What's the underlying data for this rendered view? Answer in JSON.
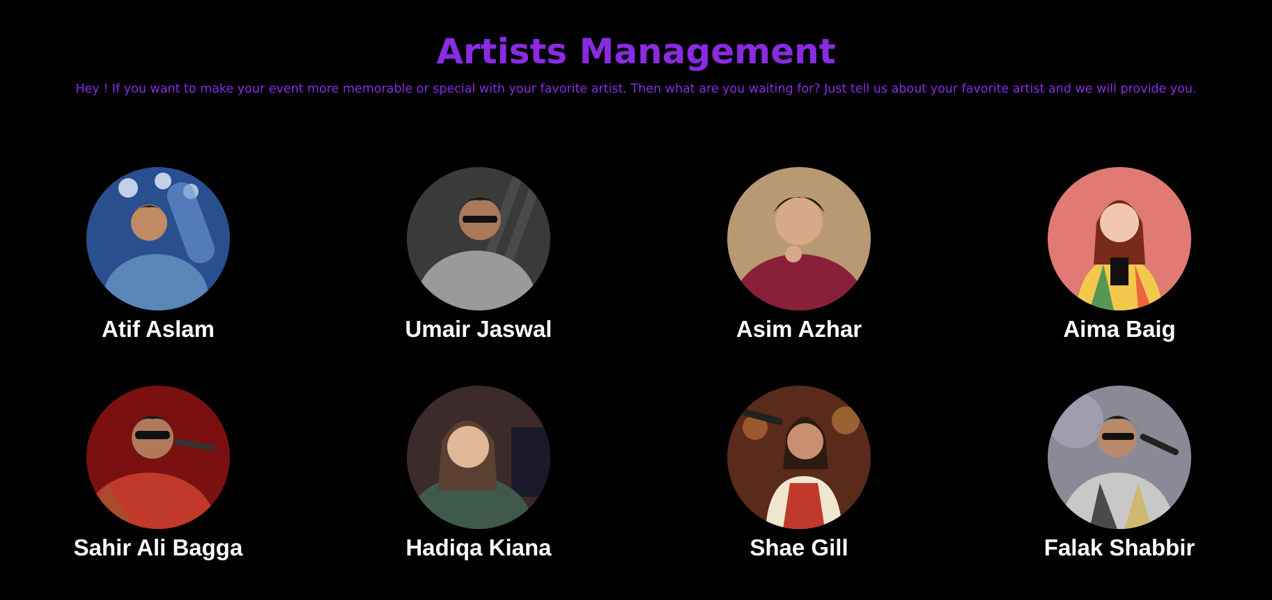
{
  "page": {
    "title": "Artists Management",
    "subtitle": "Hey ! If you want to make your event more memorable or special with your favorite artist. Then what are you waiting for? Just tell us about your favorite artist and we will provide you.",
    "accent_color": "#8a2be2",
    "background_color": "#000000"
  },
  "artists": [
    {
      "name": "Atif Aslam",
      "photo_bg": "#2a4f8f",
      "photo_accent": "#6f9ad6"
    },
    {
      "name": "Umair Jaswal",
      "photo_bg": "#3a3a3a",
      "photo_accent": "#9a9a9a"
    },
    {
      "name": "Asim Azhar",
      "photo_bg": "#b79a73",
      "photo_accent": "#8a1f3a"
    },
    {
      "name": "Aima Baig",
      "photo_bg": "#e07a73",
      "photo_accent": "#f2c94c"
    },
    {
      "name": "Sahir Ali Bagga",
      "photo_bg": "#7a1010",
      "photo_accent": "#c0392b"
    },
    {
      "name": "Hadiqa Kiana",
      "photo_bg": "#3d2a2a",
      "photo_accent": "#3f5a4a"
    },
    {
      "name": "Shae Gill",
      "photo_bg": "#5a2a1a",
      "photo_accent": "#c0392b"
    },
    {
      "name": "Falak Shabbir",
      "photo_bg": "#8a8a96",
      "photo_accent": "#c8c8c8"
    }
  ]
}
